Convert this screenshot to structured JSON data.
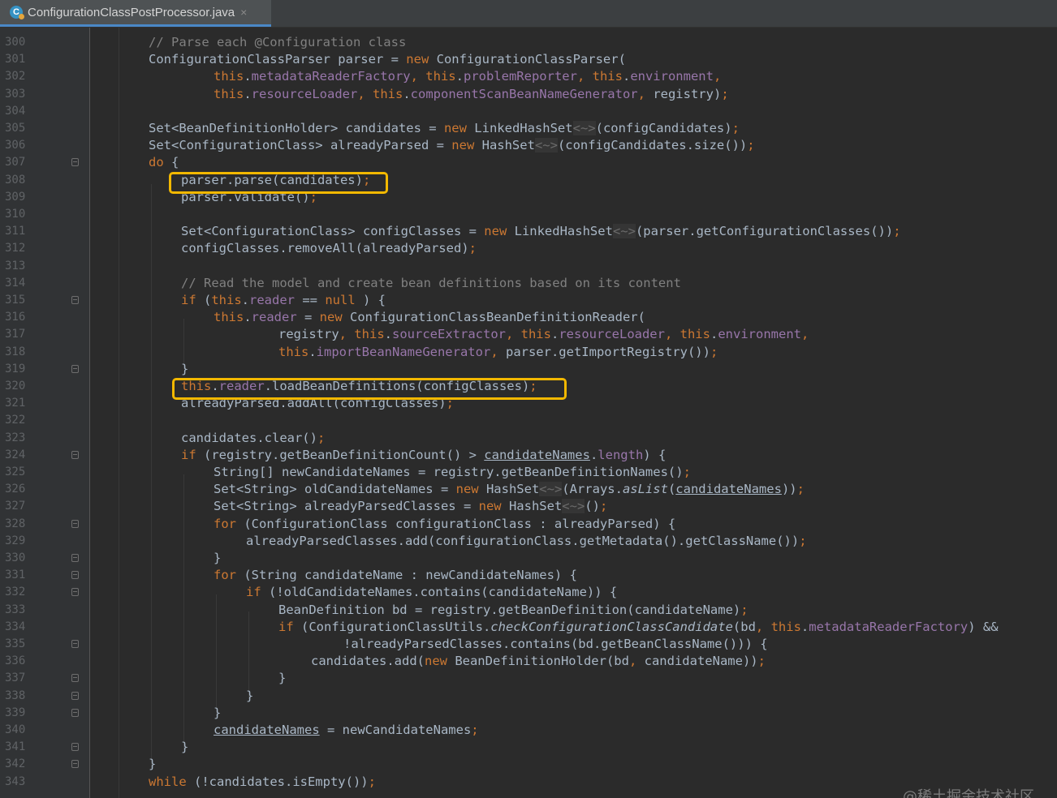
{
  "tab": {
    "title": "ConfigurationClassPostProcessor.java",
    "close": "×",
    "icon": "C"
  },
  "watermark": "@稀土掘金技术社区",
  "lines": [
    {
      "n": "300",
      "i": 0,
      "f": false,
      "t": [
        [
          "cm",
          "// Parse each @Configuration class"
        ]
      ]
    },
    {
      "n": "301",
      "i": 0,
      "f": false,
      "t": [
        [
          "",
          "ConfigurationClassParser parser = "
        ],
        [
          "kw",
          "new "
        ],
        [
          "",
          "ConfigurationClassParser("
        ]
      ]
    },
    {
      "n": "302",
      "i": 2,
      "f": false,
      "t": [
        [
          "kw",
          "this"
        ],
        [
          "",
          "."
        ],
        [
          "fd",
          "metadataReaderFactory"
        ],
        [
          "kw",
          ", this"
        ],
        [
          "",
          "."
        ],
        [
          "fd",
          "problemReporter"
        ],
        [
          "kw",
          ", this"
        ],
        [
          "",
          "."
        ],
        [
          "fd",
          "environment"
        ],
        [
          "kw",
          ","
        ]
      ]
    },
    {
      "n": "303",
      "i": 2,
      "f": false,
      "t": [
        [
          "kw",
          "this"
        ],
        [
          "",
          "."
        ],
        [
          "fd",
          "resourceLoader"
        ],
        [
          "kw",
          ", this"
        ],
        [
          "",
          "."
        ],
        [
          "fd",
          "componentScanBeanNameGenerator"
        ],
        [
          "kw",
          ", "
        ],
        [
          "",
          "registry)"
        ],
        [
          "kw",
          ";"
        ]
      ]
    },
    {
      "n": "304",
      "i": 0,
      "f": false,
      "t": []
    },
    {
      "n": "305",
      "i": 0,
      "f": false,
      "t": [
        [
          "",
          "Set<BeanDefinitionHolder> candidates = "
        ],
        [
          "kw",
          "new "
        ],
        [
          "",
          "LinkedHashSet"
        ],
        [
          "dim",
          "<~>"
        ],
        [
          "",
          "(configCandidates)"
        ],
        [
          "kw",
          ";"
        ]
      ]
    },
    {
      "n": "306",
      "i": 0,
      "f": false,
      "t": [
        [
          "",
          "Set<ConfigurationClass> alreadyParsed = "
        ],
        [
          "kw",
          "new "
        ],
        [
          "",
          "HashSet"
        ],
        [
          "dim",
          "<~>"
        ],
        [
          "",
          "(configCandidates.size())"
        ],
        [
          "kw",
          ";"
        ]
      ]
    },
    {
      "n": "307",
      "i": 0,
      "f": true,
      "t": [
        [
          "kw",
          "do "
        ],
        [
          "",
          "{"
        ]
      ]
    },
    {
      "n": "308",
      "i": 1,
      "f": false,
      "t": [
        [
          "",
          "parser.parse(candidates)"
        ],
        [
          "kw",
          ";"
        ]
      ]
    },
    {
      "n": "309",
      "i": 1,
      "f": false,
      "t": [
        [
          "",
          "parser.validate()"
        ],
        [
          "kw",
          ";"
        ]
      ]
    },
    {
      "n": "310",
      "i": 0,
      "f": false,
      "t": []
    },
    {
      "n": "311",
      "i": 1,
      "f": false,
      "t": [
        [
          "",
          "Set<ConfigurationClass> configClasses = "
        ],
        [
          "kw",
          "new "
        ],
        [
          "",
          "LinkedHashSet"
        ],
        [
          "dim",
          "<~>"
        ],
        [
          "",
          "(parser.getConfigurationClasses())"
        ],
        [
          "kw",
          ";"
        ]
      ]
    },
    {
      "n": "312",
      "i": 1,
      "f": false,
      "t": [
        [
          "",
          "configClasses.removeAll(alreadyParsed)"
        ],
        [
          "kw",
          ";"
        ]
      ]
    },
    {
      "n": "313",
      "i": 0,
      "f": false,
      "t": []
    },
    {
      "n": "314",
      "i": 1,
      "f": false,
      "t": [
        [
          "cm",
          "// Read the model and create bean definitions based on its content"
        ]
      ]
    },
    {
      "n": "315",
      "i": 1,
      "f": true,
      "t": [
        [
          "kw",
          "if "
        ],
        [
          "",
          "("
        ],
        [
          "kw",
          "this"
        ],
        [
          "",
          "."
        ],
        [
          "fd",
          "reader "
        ],
        [
          "",
          "== "
        ],
        [
          "kw",
          "null"
        ],
        [
          "",
          " ) {"
        ]
      ]
    },
    {
      "n": "316",
      "i": 2,
      "f": false,
      "t": [
        [
          "kw",
          "this"
        ],
        [
          "",
          "."
        ],
        [
          "fd",
          "reader "
        ],
        [
          "",
          "= "
        ],
        [
          "kw",
          "new "
        ],
        [
          "",
          "ConfigurationClassBeanDefinitionReader("
        ]
      ]
    },
    {
      "n": "317",
      "i": 4,
      "f": false,
      "t": [
        [
          "",
          "registry"
        ],
        [
          "kw",
          ", this"
        ],
        [
          "",
          "."
        ],
        [
          "fd",
          "sourceExtractor"
        ],
        [
          "kw",
          ", this"
        ],
        [
          "",
          "."
        ],
        [
          "fd",
          "resourceLoader"
        ],
        [
          "kw",
          ", this"
        ],
        [
          "",
          "."
        ],
        [
          "fd",
          "environment"
        ],
        [
          "kw",
          ","
        ]
      ]
    },
    {
      "n": "318",
      "i": 4,
      "f": false,
      "t": [
        [
          "kw",
          "this"
        ],
        [
          "",
          "."
        ],
        [
          "fd",
          "importBeanNameGenerator"
        ],
        [
          "kw",
          ", "
        ],
        [
          "",
          "parser.getImportRegistry())"
        ],
        [
          "kw",
          ";"
        ]
      ]
    },
    {
      "n": "319",
      "i": 1,
      "f": true,
      "t": [
        [
          "",
          "}"
        ]
      ]
    },
    {
      "n": "320",
      "i": 1,
      "f": false,
      "t": [
        [
          "kw",
          "this"
        ],
        [
          "",
          "."
        ],
        [
          "fd",
          "reader"
        ],
        [
          "",
          ".loadBeanDefinitions(configClasses)"
        ],
        [
          "kw",
          ";"
        ]
      ]
    },
    {
      "n": "321",
      "i": 1,
      "f": false,
      "t": [
        [
          "",
          "alreadyParsed.addAll(configClasses)"
        ],
        [
          "kw",
          ";"
        ]
      ]
    },
    {
      "n": "322",
      "i": 0,
      "f": false,
      "t": []
    },
    {
      "n": "323",
      "i": 1,
      "f": false,
      "t": [
        [
          "",
          "candidates.clear()"
        ],
        [
          "kw",
          ";"
        ]
      ]
    },
    {
      "n": "324",
      "i": 1,
      "f": true,
      "t": [
        [
          "kw",
          "if "
        ],
        [
          "",
          "(registry.getBeanDefinitionCount() > "
        ],
        [
          "ul",
          "candidateNames"
        ],
        [
          "",
          "."
        ],
        [
          "fd",
          "length"
        ],
        [
          "",
          ") {"
        ]
      ]
    },
    {
      "n": "325",
      "i": 2,
      "f": false,
      "t": [
        [
          "",
          "String[] newCandidateNames = registry.getBeanDefinitionNames()"
        ],
        [
          "kw",
          ";"
        ]
      ]
    },
    {
      "n": "326",
      "i": 2,
      "f": false,
      "t": [
        [
          "",
          "Set<String> oldCandidateNames = "
        ],
        [
          "kw",
          "new "
        ],
        [
          "",
          "HashSet"
        ],
        [
          "dim",
          "<~>"
        ],
        [
          "",
          "(Arrays."
        ],
        [
          "it",
          "asList"
        ],
        [
          "",
          "("
        ],
        [
          "ul",
          "candidateNames"
        ],
        [
          "",
          "))"
        ],
        [
          "kw",
          ";"
        ]
      ]
    },
    {
      "n": "327",
      "i": 2,
      "f": false,
      "t": [
        [
          "",
          "Set<String> alreadyParsedClasses = "
        ],
        [
          "kw",
          "new "
        ],
        [
          "",
          "HashSet"
        ],
        [
          "dim",
          "<~>"
        ],
        [
          "",
          "()"
        ],
        [
          "kw",
          ";"
        ]
      ]
    },
    {
      "n": "328",
      "i": 2,
      "f": true,
      "t": [
        [
          "kw",
          "for "
        ],
        [
          "",
          "(ConfigurationClass configurationClass : alreadyParsed) {"
        ]
      ]
    },
    {
      "n": "329",
      "i": 3,
      "f": false,
      "t": [
        [
          "",
          "alreadyParsedClasses.add(configurationClass.getMetadata().getClassName())"
        ],
        [
          "kw",
          ";"
        ]
      ]
    },
    {
      "n": "330",
      "i": 2,
      "f": true,
      "t": [
        [
          "",
          "}"
        ]
      ]
    },
    {
      "n": "331",
      "i": 2,
      "f": true,
      "t": [
        [
          "kw",
          "for "
        ],
        [
          "",
          "(String candidateName : newCandidateNames) {"
        ]
      ]
    },
    {
      "n": "332",
      "i": 3,
      "f": true,
      "t": [
        [
          "kw",
          "if "
        ],
        [
          "",
          "(!oldCandidateNames.contains(candidateName)) {"
        ]
      ]
    },
    {
      "n": "333",
      "i": 4,
      "f": false,
      "t": [
        [
          "",
          "BeanDefinition bd = registry.getBeanDefinition(candidateName)"
        ],
        [
          "kw",
          ";"
        ]
      ]
    },
    {
      "n": "334",
      "i": 4,
      "f": false,
      "t": [
        [
          "kw",
          "if "
        ],
        [
          "",
          "(ConfigurationClassUtils."
        ],
        [
          "it",
          "checkConfigurationClassCandidate"
        ],
        [
          "",
          "(bd"
        ],
        [
          "kw",
          ", this"
        ],
        [
          "",
          "."
        ],
        [
          "fd",
          "metadataReaderFactory"
        ],
        [
          "",
          ") &&"
        ]
      ]
    },
    {
      "n": "335",
      "i": 6,
      "f": true,
      "t": [
        [
          "",
          "!alreadyParsedClasses.contains(bd.getBeanClassName())) {"
        ]
      ]
    },
    {
      "n": "336",
      "i": 5,
      "f": false,
      "t": [
        [
          "",
          "candidates.add("
        ],
        [
          "kw",
          "new "
        ],
        [
          "",
          "BeanDefinitionHolder(bd"
        ],
        [
          "kw",
          ", "
        ],
        [
          "",
          "candidateName))"
        ],
        [
          "kw",
          ";"
        ]
      ]
    },
    {
      "n": "337",
      "i": 4,
      "f": true,
      "t": [
        [
          "",
          "}"
        ]
      ]
    },
    {
      "n": "338",
      "i": 3,
      "f": true,
      "t": [
        [
          "",
          "}"
        ]
      ]
    },
    {
      "n": "339",
      "i": 2,
      "f": true,
      "t": [
        [
          "",
          "}"
        ]
      ]
    },
    {
      "n": "340",
      "i": 2,
      "f": false,
      "t": [
        [
          "ul",
          "candidateNames"
        ],
        [
          "",
          " = newCandidateNames"
        ],
        [
          "kw",
          ";"
        ]
      ]
    },
    {
      "n": "341",
      "i": 1,
      "f": true,
      "t": [
        [
          "",
          "}"
        ]
      ]
    },
    {
      "n": "342",
      "i": 0,
      "f": true,
      "t": [
        [
          "",
          "}"
        ]
      ]
    },
    {
      "n": "343",
      "i": 0,
      "f": false,
      "t": [
        [
          "kw",
          "while "
        ],
        [
          "",
          "(!candidates.isEmpty())"
        ],
        [
          "kw",
          ";"
        ]
      ]
    }
  ]
}
